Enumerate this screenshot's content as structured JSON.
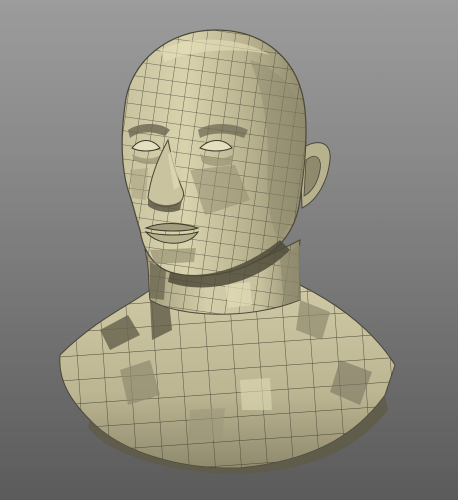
{
  "viewport": {
    "background_top": "#9c9c9c",
    "background_bottom": "#5b5b5b"
  },
  "model": {
    "subject": "head-bust-mesh",
    "wire_color": "#4a4838",
    "face_colors": {
      "lit": "#d8d2ad",
      "mid": "#bbb592",
      "shade": "#8f8a6d",
      "dark": "#5f5b47"
    }
  }
}
